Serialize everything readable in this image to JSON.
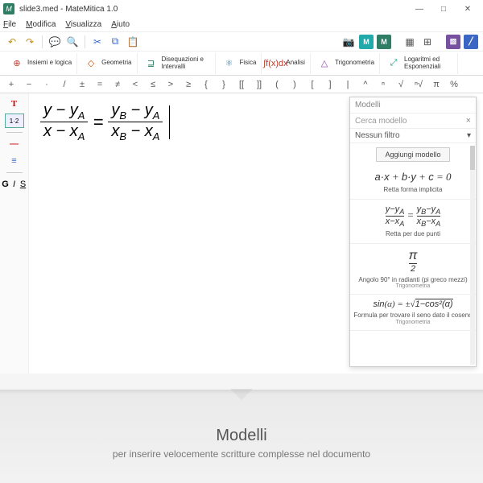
{
  "window": {
    "title": "slide3.med - MateMitica 1.0",
    "min": "—",
    "max": "□",
    "close": "✕"
  },
  "menu": {
    "file": "File",
    "edit": "Modifica",
    "view": "Visualizza",
    "help": "Aiuto"
  },
  "toolbar_icons": {
    "undo": "↶",
    "redo": "↷",
    "speak": "💬",
    "search": "🔍",
    "cut": "✂",
    "copy": "⧉",
    "paste": "📋"
  },
  "right_icons": {
    "cam": "📷",
    "m": "M",
    "grid": "▦",
    "apps": "⊞",
    "swatch": "▧",
    "slash": "╱"
  },
  "categories": [
    {
      "icon": "⊕",
      "color": "#c0392b",
      "label": "Insiemi e logica"
    },
    {
      "icon": "◇",
      "color": "#d35400",
      "label": "Geometria"
    },
    {
      "icon": "⊒",
      "color": "#2e7d64",
      "label": "Disequazioni e Intervalli"
    },
    {
      "icon": "⚛",
      "color": "#2980b9",
      "label": "Fisica"
    },
    {
      "icon": "∫f(x)dx",
      "color": "#c0392b",
      "label": "Analisi"
    },
    {
      "icon": "△",
      "color": "#8e44ad",
      "label": "Trigonometria"
    },
    {
      "icon": "⤢",
      "color": "#16a085",
      "label": "Logaritmi ed Esponenziali"
    }
  ],
  "symbols": [
    "+",
    "−",
    "·",
    "/",
    "±",
    "=",
    "≠",
    "<",
    "≤",
    ">",
    "≥",
    "{",
    "}",
    "[[",
    "]]",
    "(",
    ")",
    "[",
    "]",
    "|",
    "^",
    "ⁿ",
    "√",
    "ⁿ√",
    "π",
    "%"
  ],
  "side": {
    "t": "T",
    "frac": "1·2",
    "line": "—",
    "stack": "≡",
    "g": "G",
    "i": "I",
    "s": "S"
  },
  "models_panel": {
    "title": "Modelli",
    "search_placeholder": "Cerca modello",
    "filter": "Nessun filtro",
    "add": "Aggiungi modello",
    "items": [
      {
        "name": "Retta forma implicita",
        "cat": ""
      },
      {
        "name": "Retta per due punti",
        "cat": ""
      },
      {
        "name": "Angolo 90° in radianti (pi greco mezzi)",
        "cat": "Trigonometria"
      },
      {
        "name": "Formula per trovare il seno dato il coseno",
        "cat": "Trigonometria"
      }
    ]
  },
  "caption": {
    "title": "Modelli",
    "sub": "per inserire velocemente scritture complesse nel documento"
  }
}
